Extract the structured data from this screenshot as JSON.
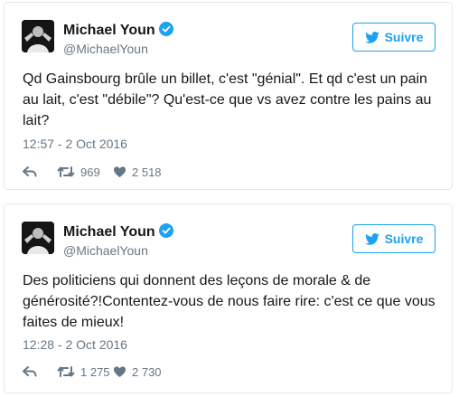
{
  "tweets": [
    {
      "name": "Michael Youn",
      "handle": "@MichaelYoun",
      "follow_label": "Suivre",
      "text": "Qd Gainsbourg brûle un billet, c'est \"génial\". Et qd c'est un pain\nau lait, c'est \"débile\"? Qu'est-ce que vs avez contre les pains au\nlait?",
      "timestamp": "12:57 - 2 Oct 2016",
      "retweets": "969",
      "likes": "2 518"
    },
    {
      "name": "Michael Youn",
      "handle": "@MichaelYoun",
      "follow_label": "Suivre",
      "text": "Des politiciens qui donnent des leçons de morale & de\ngénérosité?!Contentez-vous de nous faire rire: c'est ce que vous\nfaites de mieux!",
      "timestamp": "12:28 - 2 Oct 2016",
      "retweets": "1 275",
      "likes": "2 730"
    }
  ],
  "colors": {
    "accent": "#1da1f2",
    "text": "#14171a",
    "muted": "#657786",
    "border": "#e1e8ed"
  },
  "icons": [
    "verified-badge-icon",
    "twitter-bird-icon",
    "reply-icon",
    "retweet-icon",
    "heart-icon",
    "avatar"
  ]
}
